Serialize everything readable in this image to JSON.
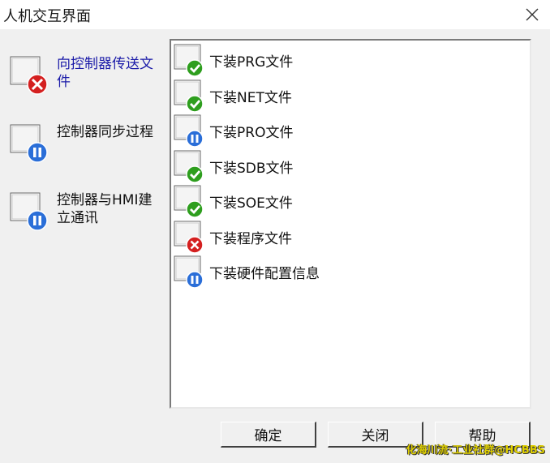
{
  "window": {
    "title": "人机交互界面",
    "close_icon": "close-icon"
  },
  "steps": [
    {
      "label": "向控制器传送文件",
      "status": "error",
      "active": true
    },
    {
      "label": "控制器同步过程",
      "status": "pending",
      "active": false
    },
    {
      "label": "控制器与HMI建立通讯",
      "status": "pending",
      "active": false
    }
  ],
  "items": [
    {
      "label": "下装PRG文件",
      "status": "success"
    },
    {
      "label": "下装NET文件",
      "status": "success"
    },
    {
      "label": "下装PRO文件",
      "status": "pending"
    },
    {
      "label": "下装SDB文件",
      "status": "success"
    },
    {
      "label": "下装SOE文件",
      "status": "success"
    },
    {
      "label": "下装程序文件",
      "status": "error"
    },
    {
      "label": "下装硬件配置信息",
      "status": "pending"
    }
  ],
  "buttons": {
    "ok": "确定",
    "close": "关闭",
    "help": "帮助"
  },
  "watermark": "化海川流·工业社群@HCBBS",
  "colors": {
    "success": "#2e9e1e",
    "error": "#d42020",
    "pending": "#2a6ed8",
    "active_text": "#1a1aa8"
  }
}
